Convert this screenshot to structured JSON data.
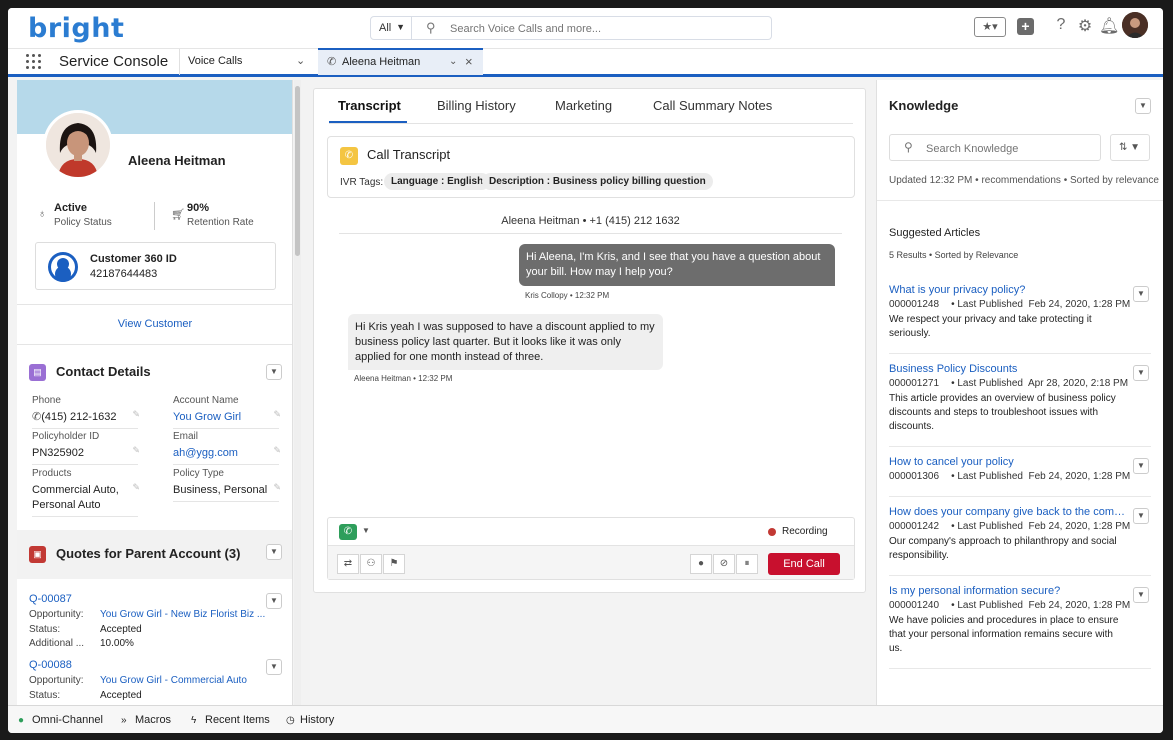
{
  "header": {
    "logo": "bright",
    "search_scope": "All",
    "search_placeholder": "Search Voice Calls and more..."
  },
  "navbar": {
    "app_name": "Service Console",
    "object_select": "Voice Calls",
    "active_tab": "Aleena Heitman"
  },
  "customer": {
    "name": "Aleena Heitman",
    "status_value": "Active",
    "status_label": "Policy Status",
    "retention_value": "90%",
    "retention_label": "Retention Rate",
    "c360_title": "Customer 360 ID",
    "c360_id": "42187644483",
    "view_link": "View Customer"
  },
  "contact": {
    "title": "Contact Details",
    "fields": [
      {
        "label": "Phone",
        "value": "(415) 212-1632"
      },
      {
        "label": "Account Name",
        "value": "You Grow Girl"
      },
      {
        "label": "Policyholder ID",
        "value": "PN325902"
      },
      {
        "label": "Email",
        "value": "ah@ygg.com"
      },
      {
        "label": "Products",
        "value": "Commercial Auto, Personal Auto"
      },
      {
        "label": "Policy Type",
        "value": "Business, Personal"
      }
    ]
  },
  "quotes": {
    "title": "Quotes for Parent Account (3)",
    "items": [
      {
        "id": "Q-00087",
        "opp_label": "Opportunity:",
        "opp": "You Grow Girl - New Biz Florist Biz ...",
        "status_label": "Status:",
        "status": "Accepted",
        "add_label": "Additional ...",
        "add": "10.00%"
      },
      {
        "id": "Q-00088",
        "opp_label": "Opportunity:",
        "opp": "You Grow Girl - Commercial Auto",
        "status_label": "Status:",
        "status": "Accepted"
      }
    ]
  },
  "center": {
    "tabs": [
      "Transcript",
      "Billing History",
      "Marketing",
      "Call Summary Notes"
    ],
    "card_title": "Call Transcript",
    "ivr_label": "IVR Tags:",
    "ivr_tags": [
      "Language : English",
      "Description : Business policy billing question"
    ],
    "caller_line": "Aleena Heitman • +1 (415) 212 1632",
    "messages": [
      {
        "text": "Hi Aleena, I'm Kris, and I see that you have a question about your bill. How may I help you?",
        "meta": "Kris Collopy • 12:32 PM"
      },
      {
        "text": "Hi Kris yeah I was supposed to have a discount applied to my business policy last quarter. But it looks like it was only applied for one month instead of three.",
        "meta": "Aleena Heitman • 12:32 PM"
      }
    ],
    "recording": "Recording",
    "end_call": "End Call"
  },
  "knowledge": {
    "title": "Knowledge",
    "search_placeholder": "Search Knowledge",
    "updated": "Updated 12:32 PM • recommendations • Sorted by relevance",
    "suggested": "Suggested Articles",
    "count": "5 Results • Sorted by Relevance",
    "articles": [
      {
        "title": "What is your privacy policy?",
        "num": "000001248",
        "pub": "Last Published",
        "date": "Feb 24, 2020, 1:28 PM",
        "desc": "We respect your privacy and take protecting it seriously."
      },
      {
        "title": "Business Policy Discounts",
        "num": "000001271",
        "pub": "Last Published",
        "date": "Apr 28, 2020, 2:18 PM",
        "desc": "This article provides an overview of business policy discounts and steps to troubleshoot issues with discounts."
      },
      {
        "title": "How to cancel your policy",
        "num": "000001306",
        "pub": "Last Published",
        "date": "Feb 24, 2020, 1:28 PM",
        "desc": ""
      },
      {
        "title": "How does your company give back to the community?",
        "num": "000001242",
        "pub": "Last Published",
        "date": "Feb 24, 2020, 1:28 PM",
        "desc": "Our company's approach to philanthropy and social responsibility."
      },
      {
        "title": "Is my personal information secure?",
        "num": "000001240",
        "pub": "Last Published",
        "date": "Feb 24, 2020, 1:28 PM",
        "desc": "We have policies and procedures in place to ensure that your personal information remains secure with us."
      }
    ]
  },
  "utility": [
    "Omni-Channel",
    "Macros",
    "Recent Items",
    "History"
  ],
  "colors": {
    "brand": "#1b5fc1",
    "end_call": "#c8102e",
    "recording": "#c23934",
    "banner": "#b6d9ea"
  }
}
